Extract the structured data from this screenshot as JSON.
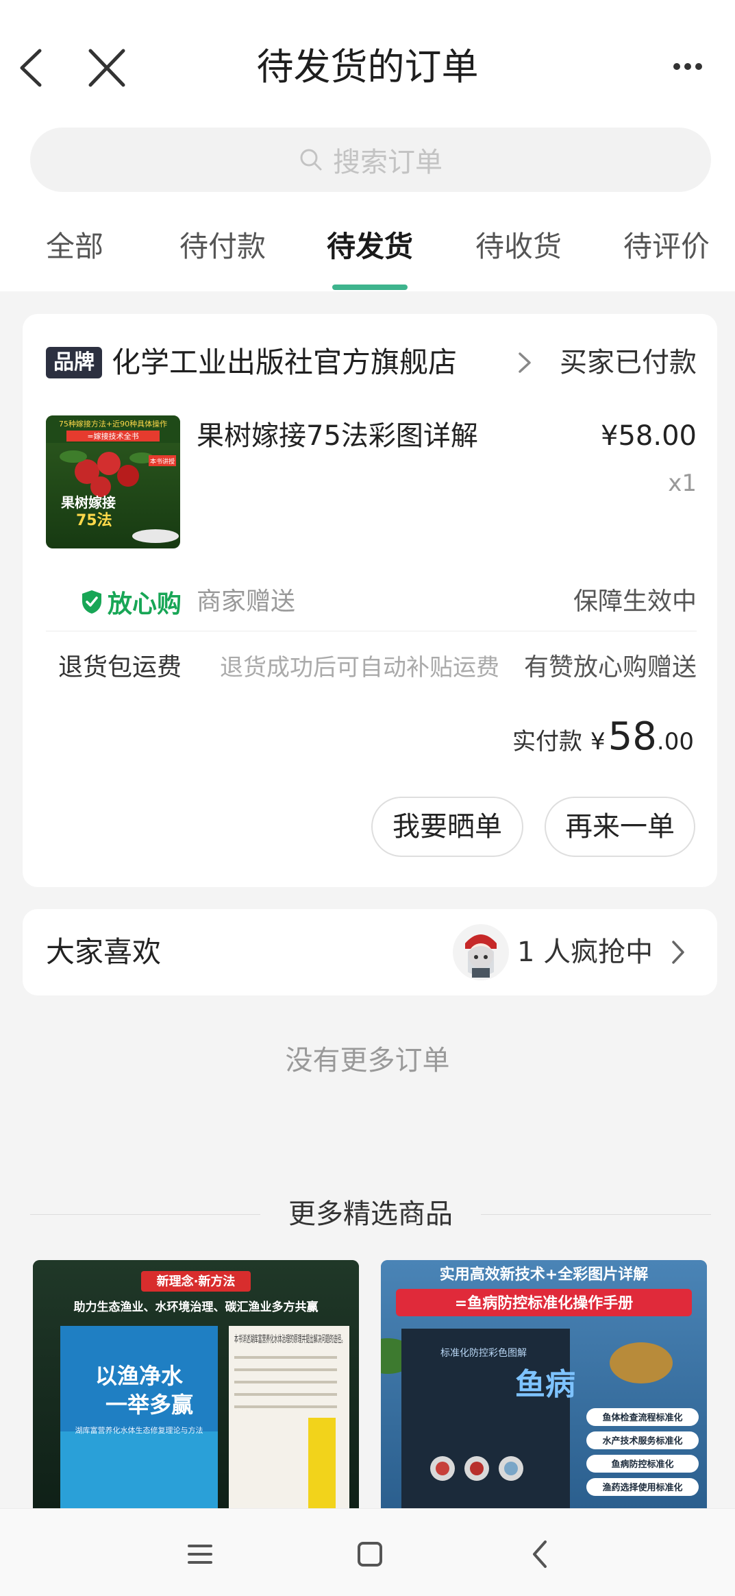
{
  "header": {
    "title": "待发货的订单",
    "back_icon": "back-arrow-icon",
    "close_icon": "close-icon",
    "more_icon": "more-icon"
  },
  "search": {
    "placeholder": "搜索订单",
    "icon": "search-icon"
  },
  "tabs": [
    {
      "label": "全部",
      "active": false
    },
    {
      "label": "待付款",
      "active": false
    },
    {
      "label": "待发货",
      "active": true
    },
    {
      "label": "待收货",
      "active": false
    },
    {
      "label": "待评价",
      "active": false
    }
  ],
  "order": {
    "brand_badge": "品牌",
    "store_name": "化学工业出版社官方旗舰店",
    "status": "买家已付款",
    "product": {
      "title": "果树嫁接75法彩图详解",
      "price": "¥58.00",
      "quantity": "x1",
      "cover_top_text": "75种嫁接方法+近90种具体操作",
      "cover_sub_text": "=嫁接技术全书",
      "cover_title": "果树嫁接",
      "cover_number": "75法",
      "cover_tag": "本书讲授"
    },
    "assurance": {
      "logo_text": "放心购",
      "gift_text": "商家赠送",
      "status": "保障生效中"
    },
    "return_shipping": {
      "label": "退货包运费",
      "description": "退货成功后可自动补贴运费",
      "gift": "有赞放心购赠送"
    },
    "paid": {
      "label": "实付款",
      "currency": "¥",
      "integer": "58",
      "decimal": ".00"
    },
    "buttons": {
      "review": "我要晒单",
      "reorder": "再来一单"
    }
  },
  "popular": {
    "title": "大家喜欢",
    "count_text": "1 人疯抢中"
  },
  "no_more": "没有更多订单",
  "recommend": {
    "title": "更多精选商品",
    "items": [
      {
        "badge": "新理念·新方法",
        "headline": "助力生态渔业、水环境治理、碳汇渔业多方共赢",
        "book_title_1": "以渔净水",
        "book_title_2": "一举多赢",
        "book_subtitle": "湖库富营养化水体生态修复理论与方法",
        "side_text": "本书详述湖库富营养化水体治理的原理并提出解决问题的途径。"
      },
      {
        "headline_1": "实用高效新技术+全彩图片详解",
        "headline_2": "=鱼病防控标准化操作手册",
        "book_title": "鱼病",
        "book_subtitle": "标准化防控彩色图解",
        "tags": [
          "鱼体检查流程标准化",
          "水产技术服务标准化",
          "鱼病防控标准化",
          "渔药选择使用标准化"
        ]
      }
    ]
  },
  "colors": {
    "accent": "#3eb48d",
    "assure_green": "#18a656",
    "badge_dark": "#2c3040",
    "background": "#f4f4f4"
  }
}
